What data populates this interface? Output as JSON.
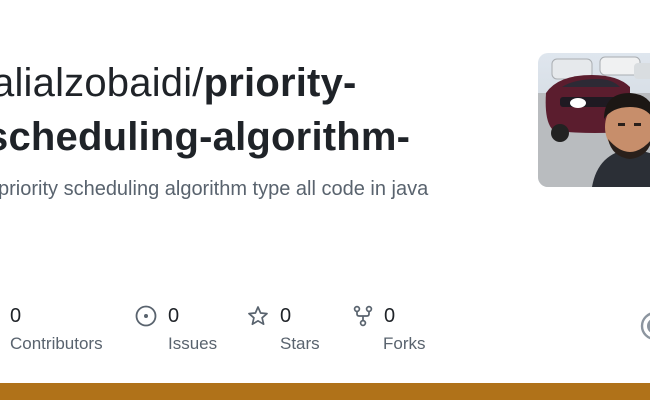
{
  "repo": {
    "owner_prefix": "alialzobaidi/",
    "name_line1": "priority-",
    "name_line2": "scheduling-algorithm-",
    "description": "priority scheduling algorithm type all code in java"
  },
  "stats": [
    {
      "icon": "contributors-icon",
      "value": "0",
      "label": "Contributors"
    },
    {
      "icon": "issues-icon",
      "value": "0",
      "label": "Issues"
    },
    {
      "icon": "star-icon",
      "value": "0",
      "label": "Stars"
    },
    {
      "icon": "fork-icon",
      "value": "0",
      "label": "Forks"
    }
  ],
  "language_color": "#b07219"
}
